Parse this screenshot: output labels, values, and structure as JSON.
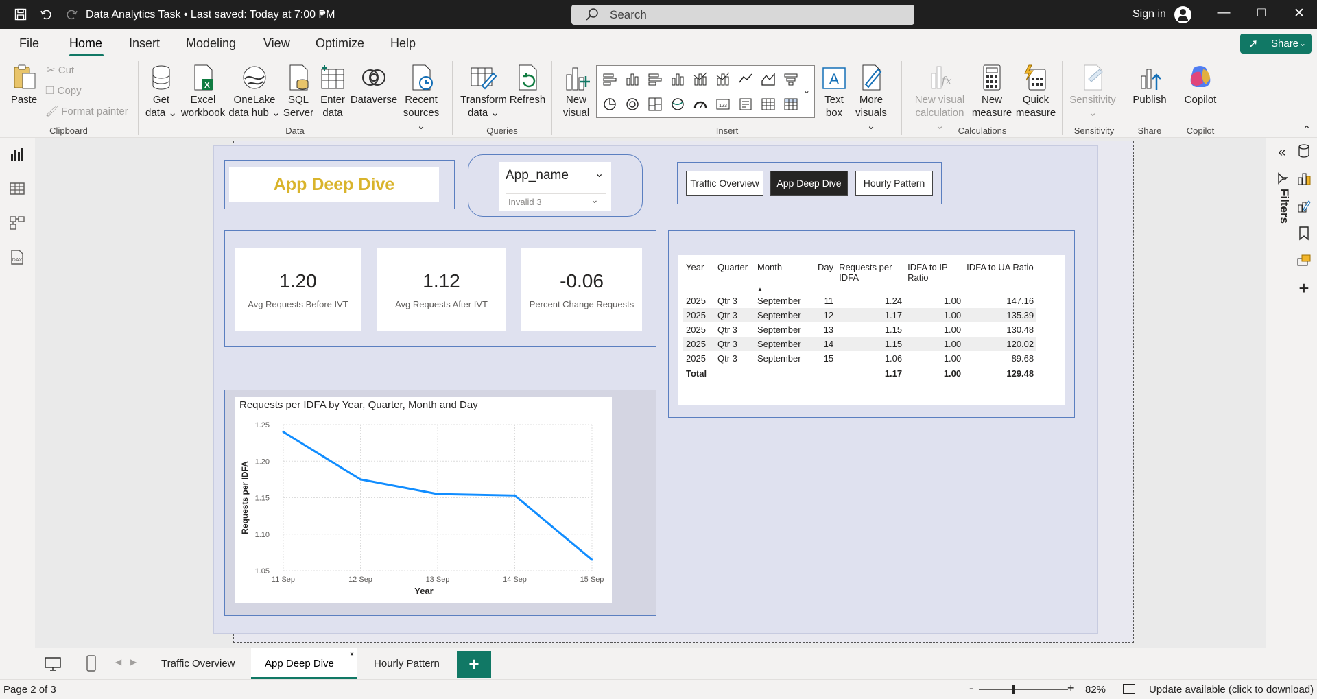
{
  "titlebar": {
    "doc_title": "Data Analytics Task • Last saved: Today at 7:00 PM",
    "search_placeholder": "Search",
    "signin": "Sign in"
  },
  "menu": [
    "File",
    "Home",
    "Insert",
    "Modeling",
    "View",
    "Optimize",
    "Help"
  ],
  "share_label": "Share",
  "ribbon": {
    "clipboard": {
      "paste": "Paste",
      "cut": "Cut",
      "copy": "Copy",
      "format_painter": "Format painter",
      "label": "Clipboard"
    },
    "data": {
      "get_data": [
        "Get",
        "data"
      ],
      "excel": [
        "Excel",
        "workbook"
      ],
      "onelake": [
        "OneLake",
        "data hub"
      ],
      "sql": [
        "SQL",
        "Server"
      ],
      "enter": [
        "Enter",
        "data"
      ],
      "dataverse": [
        "Dataverse",
        ""
      ],
      "recent": [
        "Recent",
        "sources"
      ],
      "label": "Data"
    },
    "queries": {
      "transform": [
        "Transform",
        "data"
      ],
      "refresh": "Refresh",
      "label": "Queries"
    },
    "insert": {
      "new_visual": [
        "New",
        "visual"
      ],
      "text_box": [
        "Text",
        "box"
      ],
      "more_visuals": [
        "More",
        "visuals"
      ],
      "label": "Insert"
    },
    "calculations": {
      "new_visual_calc": [
        "New visual",
        "calculation"
      ],
      "new_measure": [
        "New",
        "measure"
      ],
      "quick_measure": [
        "Quick",
        "measure"
      ],
      "label": "Calculations"
    },
    "sensitivity": {
      "btn": "Sensitivity",
      "label": "Sensitivity"
    },
    "share": {
      "publish": "Publish",
      "label": "Share"
    },
    "copilot": {
      "btn": "Copilot",
      "label": "Copilot"
    }
  },
  "report": {
    "title_card": "App Deep Dive",
    "slicer": {
      "title": "App_name",
      "selected": "Invalid 3"
    },
    "nav_buttons": [
      "Traffic Overview",
      "App Deep Dive",
      "Hourly Pattern"
    ],
    "cards": [
      {
        "value": "1.20",
        "label": "Avg Requests Before IVT"
      },
      {
        "value": "1.12",
        "label": "Avg Requests After IVT"
      },
      {
        "value": "-0.06",
        "label": "Percent Change Requests"
      }
    ],
    "matrix": {
      "headers": [
        "Year",
        "Quarter",
        "Month",
        "Day",
        "Requests per IDFA",
        "IDFA to IP Ratio",
        "IDFA to UA Ratio"
      ],
      "rows": [
        [
          "2025",
          "Qtr 3",
          "September",
          "11",
          "1.24",
          "1.00",
          "147.16"
        ],
        [
          "2025",
          "Qtr 3",
          "September",
          "12",
          "1.17",
          "1.00",
          "135.39"
        ],
        [
          "2025",
          "Qtr 3",
          "September",
          "13",
          "1.15",
          "1.00",
          "130.48"
        ],
        [
          "2025",
          "Qtr 3",
          "September",
          "14",
          "1.15",
          "1.00",
          "120.02"
        ],
        [
          "2025",
          "Qtr 3",
          "September",
          "15",
          "1.06",
          "1.00",
          "89.68"
        ]
      ],
      "total": [
        "Total",
        "",
        "",
        "",
        "1.17",
        "1.00",
        "129.48"
      ]
    }
  },
  "chart_data": {
    "type": "line",
    "title": "Requests per IDFA by Year, Quarter, Month and Day",
    "xlabel": "Year",
    "ylabel": "Requests per IDFA",
    "categories": [
      "11 Sep",
      "12 Sep",
      "13 Sep",
      "14 Sep",
      "15 Sep"
    ],
    "values": [
      1.24,
      1.175,
      1.155,
      1.153,
      1.065
    ],
    "ylim": [
      1.05,
      1.25
    ],
    "yticks": [
      "1.25",
      "1.20",
      "1.15",
      "1.10",
      "1.05"
    ],
    "grid": true,
    "color": "#118dff"
  },
  "tabs": [
    "Traffic Overview",
    "App Deep Dive",
    "Hourly Pattern"
  ],
  "active_tab": "App Deep Dive",
  "tab_close": "x",
  "status": {
    "page": "Page 2 of 3",
    "zoom": "82%",
    "update": "Update available (click to download)"
  },
  "right_filters_label": "Filters"
}
